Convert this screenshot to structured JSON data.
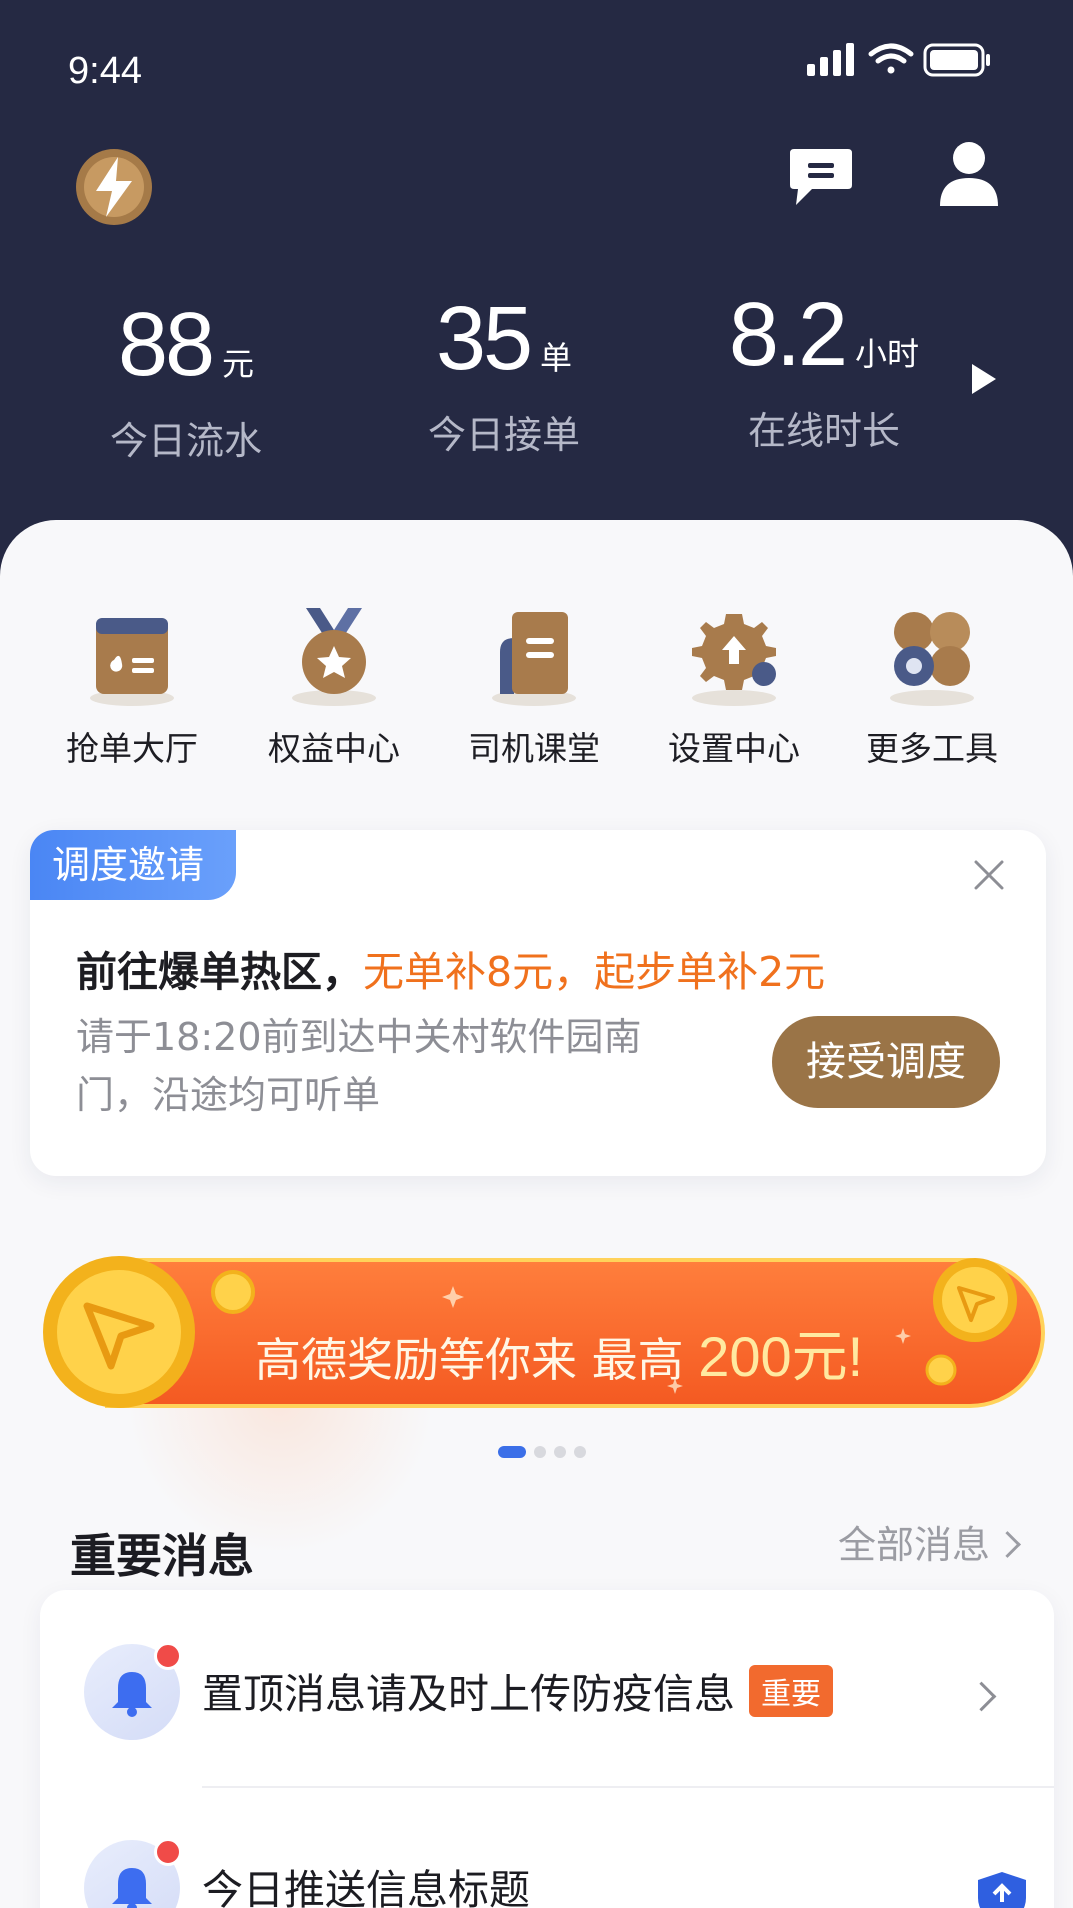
{
  "status_bar": {
    "time": "9:44"
  },
  "header": {
    "logo_icon": "lightning-logo-icon",
    "chat_icon": "chat-bubble-icon",
    "profile_icon": "user-icon"
  },
  "stats": [
    {
      "value": "88",
      "unit": "元",
      "label": "今日流水"
    },
    {
      "value": "35",
      "unit": "单",
      "label": "今日接单"
    },
    {
      "value": "8.2",
      "unit": "小时",
      "label": "在线时长"
    }
  ],
  "tools": [
    {
      "label": "抢单大厅",
      "icon": "wallet-icon"
    },
    {
      "label": "权益中心",
      "icon": "medal-icon"
    },
    {
      "label": "司机课堂",
      "icon": "book-icon"
    },
    {
      "label": "设置中心",
      "icon": "gear-icon"
    },
    {
      "label": "更多工具",
      "icon": "more-tools-icon"
    }
  ],
  "dispatch": {
    "tag": "调度邀请",
    "title_prefix": "前往爆单热区，",
    "title_highlight": "无单补8元，起步单补2元",
    "description": "请于18:20前到达中关村软件园南门，沿途均可听单",
    "button": "接受调度"
  },
  "banner": {
    "text": "高德奖励等你来 最高",
    "amount": "200元!",
    "active_slide": 1,
    "slide_count": 4
  },
  "messages": {
    "title": "重要消息",
    "all_link": "全部消息",
    "items": [
      {
        "text": "置顶消息请及时上传防疫信息",
        "badge": "重要"
      },
      {
        "text": "今日推送信息标题",
        "badge": ""
      }
    ]
  },
  "colors": {
    "header_bg": "#252943",
    "accent_brown": "#9a7447",
    "highlight_orange": "#f0711d",
    "tag_blue": "#4a86f4",
    "banner_orange": "#f45a22",
    "unread_red": "#f04b48"
  }
}
